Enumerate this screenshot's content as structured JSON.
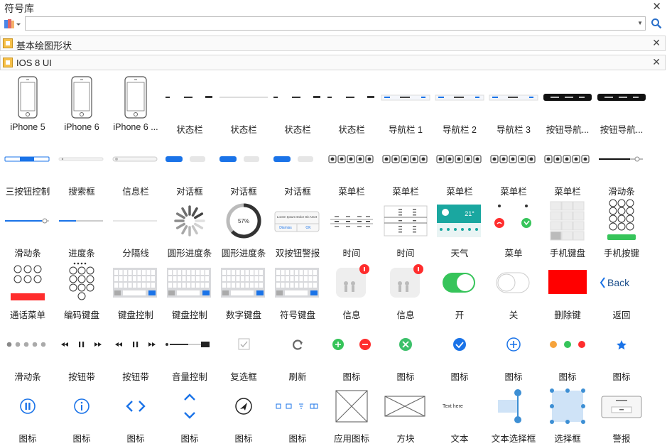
{
  "window": {
    "title": "符号库"
  },
  "sections": [
    {
      "label": "基本绘图形状"
    },
    {
      "label": "IOS 8 UI"
    }
  ],
  "shapes": [
    {
      "label": "iPhone 5",
      "icon": "iphone5-icon"
    },
    {
      "label": "iPhone 6",
      "icon": "iphone6-icon"
    },
    {
      "label": "iPhone 6 ...",
      "icon": "iphone6plus-icon"
    },
    {
      "label": "状态栏",
      "icon": "status-bar-icon"
    },
    {
      "label": "状态栏",
      "icon": "status-bar-light-icon"
    },
    {
      "label": "状态栏",
      "icon": "status-bar-icon"
    },
    {
      "label": "状态栏",
      "icon": "status-bar-icon"
    },
    {
      "label": "导航栏 1",
      "icon": "nav-bar-icon"
    },
    {
      "label": "导航栏 2",
      "icon": "nav-bar-icon"
    },
    {
      "label": "导航栏 3",
      "icon": "nav-bar-icon"
    },
    {
      "label": "按钮导航...",
      "icon": "button-nav-icon"
    },
    {
      "label": "按钮导航...",
      "icon": "button-nav-icon"
    },
    {
      "label": "三按钮控制",
      "icon": "segmented-control-icon"
    },
    {
      "label": "搜索框",
      "icon": "search-box-icon"
    },
    {
      "label": "信息栏",
      "icon": "info-bar-icon"
    },
    {
      "label": "对话框",
      "icon": "dialog-icon"
    },
    {
      "label": "对话框",
      "icon": "dialog-icon"
    },
    {
      "label": "对话框",
      "icon": "dialog-icon"
    },
    {
      "label": "菜单栏",
      "icon": "menu-bar-icon"
    },
    {
      "label": "菜单栏",
      "icon": "menu-bar-icon"
    },
    {
      "label": "菜单栏",
      "icon": "menu-bar-icon"
    },
    {
      "label": "菜单栏",
      "icon": "menu-bar-icon"
    },
    {
      "label": "菜单栏",
      "icon": "menu-bar-icon"
    },
    {
      "label": "滑动条",
      "icon": "slider-icon"
    },
    {
      "label": "滑动条",
      "icon": "slider-blue-icon"
    },
    {
      "label": "进度条",
      "icon": "progress-bar-icon"
    },
    {
      "label": "分隔线",
      "icon": "divider-icon"
    },
    {
      "label": "圆形进度条",
      "icon": "spinner-icon"
    },
    {
      "label": "圆形进度条",
      "icon": "circular-progress-icon"
    },
    {
      "label": "双按钮警报",
      "icon": "two-button-alert-icon"
    },
    {
      "label": "时间",
      "icon": "time-picker-icon"
    },
    {
      "label": "时间",
      "icon": "date-picker-icon"
    },
    {
      "label": "天气",
      "icon": "weather-icon"
    },
    {
      "label": "菜单",
      "icon": "call-menu-icon"
    },
    {
      "label": "手机键盘",
      "icon": "phone-keypad-icon"
    },
    {
      "label": "手机按键",
      "icon": "phone-buttons-icon"
    },
    {
      "label": "通话菜单",
      "icon": "call-controls-icon"
    },
    {
      "label": "编码键盘",
      "icon": "passcode-keypad-icon"
    },
    {
      "label": "键盘控制",
      "icon": "keyboard-icon"
    },
    {
      "label": "键盘控制",
      "icon": "keyboard-icon"
    },
    {
      "label": "数字键盘",
      "icon": "keyboard-icon"
    },
    {
      "label": "符号键盘",
      "icon": "keyboard-icon"
    },
    {
      "label": "信息",
      "icon": "message-badge-icon"
    },
    {
      "label": "信息",
      "icon": "message-badge-icon"
    },
    {
      "label": "开",
      "icon": "toggle-on-icon"
    },
    {
      "label": "关",
      "icon": "toggle-off-icon"
    },
    {
      "label": "删除键",
      "icon": "delete-key-icon"
    },
    {
      "label": "返回",
      "icon": "back-button-icon"
    },
    {
      "label": "滑动条",
      "icon": "page-dots-icon"
    },
    {
      "label": "按钮带",
      "icon": "media-controls-icon"
    },
    {
      "label": "按钮带",
      "icon": "media-controls-icon"
    },
    {
      "label": "音量控制",
      "icon": "volume-control-icon"
    },
    {
      "label": "复选框",
      "icon": "checkbox-icon"
    },
    {
      "label": "刷新",
      "icon": "refresh-icon"
    },
    {
      "label": "图标",
      "icon": "add-remove-icon"
    },
    {
      "label": "图标",
      "icon": "clear-icon"
    },
    {
      "label": "图标",
      "icon": "checkmark-circle-icon"
    },
    {
      "label": "图标",
      "icon": "add-circle-icon"
    },
    {
      "label": "图标",
      "icon": "traffic-lights-icon"
    },
    {
      "label": "图标",
      "icon": "star-icon"
    },
    {
      "label": "图标",
      "icon": "pause-circle-icon"
    },
    {
      "label": "图标",
      "icon": "info-circle-icon"
    },
    {
      "label": "图标",
      "icon": "chevrons-left-right-icon"
    },
    {
      "label": "图标",
      "icon": "chevrons-up-down-icon"
    },
    {
      "label": "图标",
      "icon": "navigation-arrow-icon"
    },
    {
      "label": "图标",
      "icon": "toolbar-icons-icon"
    },
    {
      "label": "应用图标",
      "icon": "app-icon-placeholder-icon"
    },
    {
      "label": "方块",
      "icon": "image-placeholder-icon"
    },
    {
      "label": "文本",
      "icon": "text-icon"
    },
    {
      "label": "文本选择框",
      "icon": "text-selection-icon"
    },
    {
      "label": "选择框",
      "icon": "selection-box-icon"
    },
    {
      "label": "警报",
      "icon": "alert-icon"
    }
  ],
  "thumbs": {
    "text_here": "Text here",
    "weather_temp": "21°",
    "progress_pct": "57%",
    "back_label": "Back",
    "alert_title": "Lorem Ipsum Dolor Sit Amet",
    "alert_cancel": "Dismiss",
    "alert_ok": "OK"
  },
  "colors": {
    "ios_blue": "#1a73e8",
    "ios_green": "#36c45a",
    "ios_red": "#ff2d2d",
    "bar_black": "#111111"
  }
}
